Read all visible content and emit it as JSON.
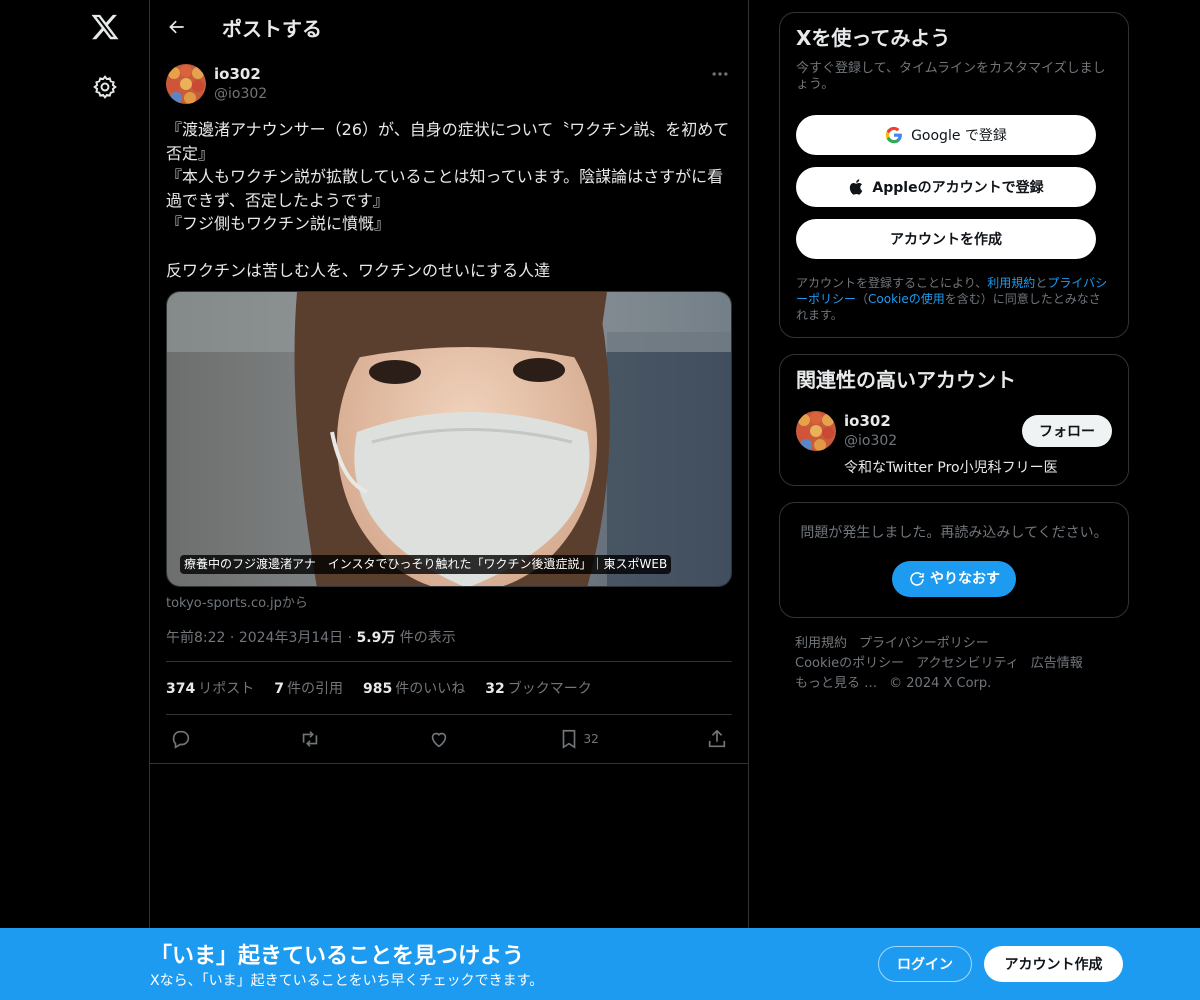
{
  "colors": {
    "accent": "#1d9bf0",
    "background": "#000000",
    "border": "#2f3336",
    "muted": "#71767b"
  },
  "header": {
    "title": "ポストする"
  },
  "post": {
    "author_name": "io302",
    "author_handle": "@io302",
    "text": "『渡邊渚アナウンサー（26）が、自身の症状について〝ワクチン説〟を初めて否定』\n『本人もワクチン説が拡散していることは知っています。陰謀論はさすがに看過できず、否定したようです』\n『フジ側もワクチン説に憤慨』\n\n反ワクチンは苦しむ人を、ワクチンのせいにする人達",
    "card_caption": "療養中のフジ渡邊渚アナ　インスタでひっそり触れた「ワクチン後遺症説」｜東スポWEB",
    "card_source": "tokyo-sports.co.jpから",
    "time": "午前8:22",
    "date": "2024年3月14日",
    "views": "5.9万",
    "views_label": "件の表示",
    "reposts": "374",
    "reposts_label": "リポスト",
    "quotes": "7",
    "quotes_label": "件の引用",
    "likes": "985",
    "likes_label": "件のいいね",
    "bookmarks": "32",
    "bookmarks_label": "ブックマーク",
    "bookmark_count": "32"
  },
  "signup": {
    "title": "Xを使ってみよう",
    "subtitle": "今すぐ登録して、タイムラインをカスタマイズしましょう。",
    "google_label": "Google で登録",
    "apple_label": "Appleのアカウントで登録",
    "create_label": "アカウントを作成",
    "legal_prefix": "アカウントを登録することにより、",
    "legal_terms": "利用規約",
    "legal_and": "と",
    "legal_privacy": "プライバシーポリシー",
    "legal_open": "（",
    "legal_cookie": "Cookieの使用",
    "legal_suffix": "を含む）に同意したとみなされます。"
  },
  "related": {
    "title": "関連性の高いアカウント",
    "name": "io302",
    "handle": "@io302",
    "bio": "令和なTwitter Pro小児科フリー医",
    "follow_label": "フォロー"
  },
  "error": {
    "message": "問題が発生しました。再読み込みしてください。",
    "retry_label": "やりなおす"
  },
  "footer": {
    "links": [
      "利用規約",
      "プライバシーポリシー",
      "Cookieのポリシー",
      "アクセシビリティ",
      "広告情報",
      "もっと見る …",
      "© 2024 X Corp."
    ]
  },
  "banner": {
    "title": "「いま」起きていることを見つけよう",
    "subtitle": "Xなら、「いま」起きていることをいち早くチェックできます。",
    "login_label": "ログイン",
    "signup_label": "アカウント作成"
  }
}
